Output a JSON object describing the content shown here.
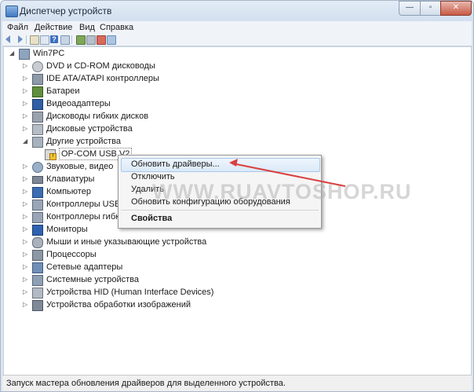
{
  "window": {
    "title": "Диспетчер устройств",
    "min": "—",
    "max": "▫",
    "close": "✕"
  },
  "menu": [
    "Файл",
    "Действие",
    "Вид",
    "Справка"
  ],
  "tree": {
    "root": "Win7PC",
    "categories": [
      "DVD и CD-ROM дисководы",
      "IDE ATA/ATAPI контроллеры",
      "Батареи",
      "Видеоадаптеры",
      "Дисководы гибких дисков",
      "Дисковые устройства",
      "Другие устройства",
      "OP-COM USB V2",
      "Звуковые, видео",
      "Клавиатуры",
      "Компьютер",
      "Контроллеры USB",
      "Контроллеры гибк",
      "Мониторы",
      "Мыши и иные указывающие устройства",
      "Процессоры",
      "Сетевые адаптеры",
      "Системные устройства",
      "Устройства HID (Human Interface Devices)",
      "Устройства обработки изображений"
    ]
  },
  "context_menu": {
    "items": [
      "Обновить драйверы...",
      "Отключить",
      "Удалить",
      "Обновить конфигурацию оборудования",
      "Свойства"
    ]
  },
  "watermark": "WWW.RUAVTOSHOP.RU",
  "status": "Запуск мастера обновления драйверов для выделенного устройства.",
  "colors": {
    "arrow": "#d94040",
    "highlight": "#dbe9f8",
    "titlebar": "#d2dfee"
  }
}
